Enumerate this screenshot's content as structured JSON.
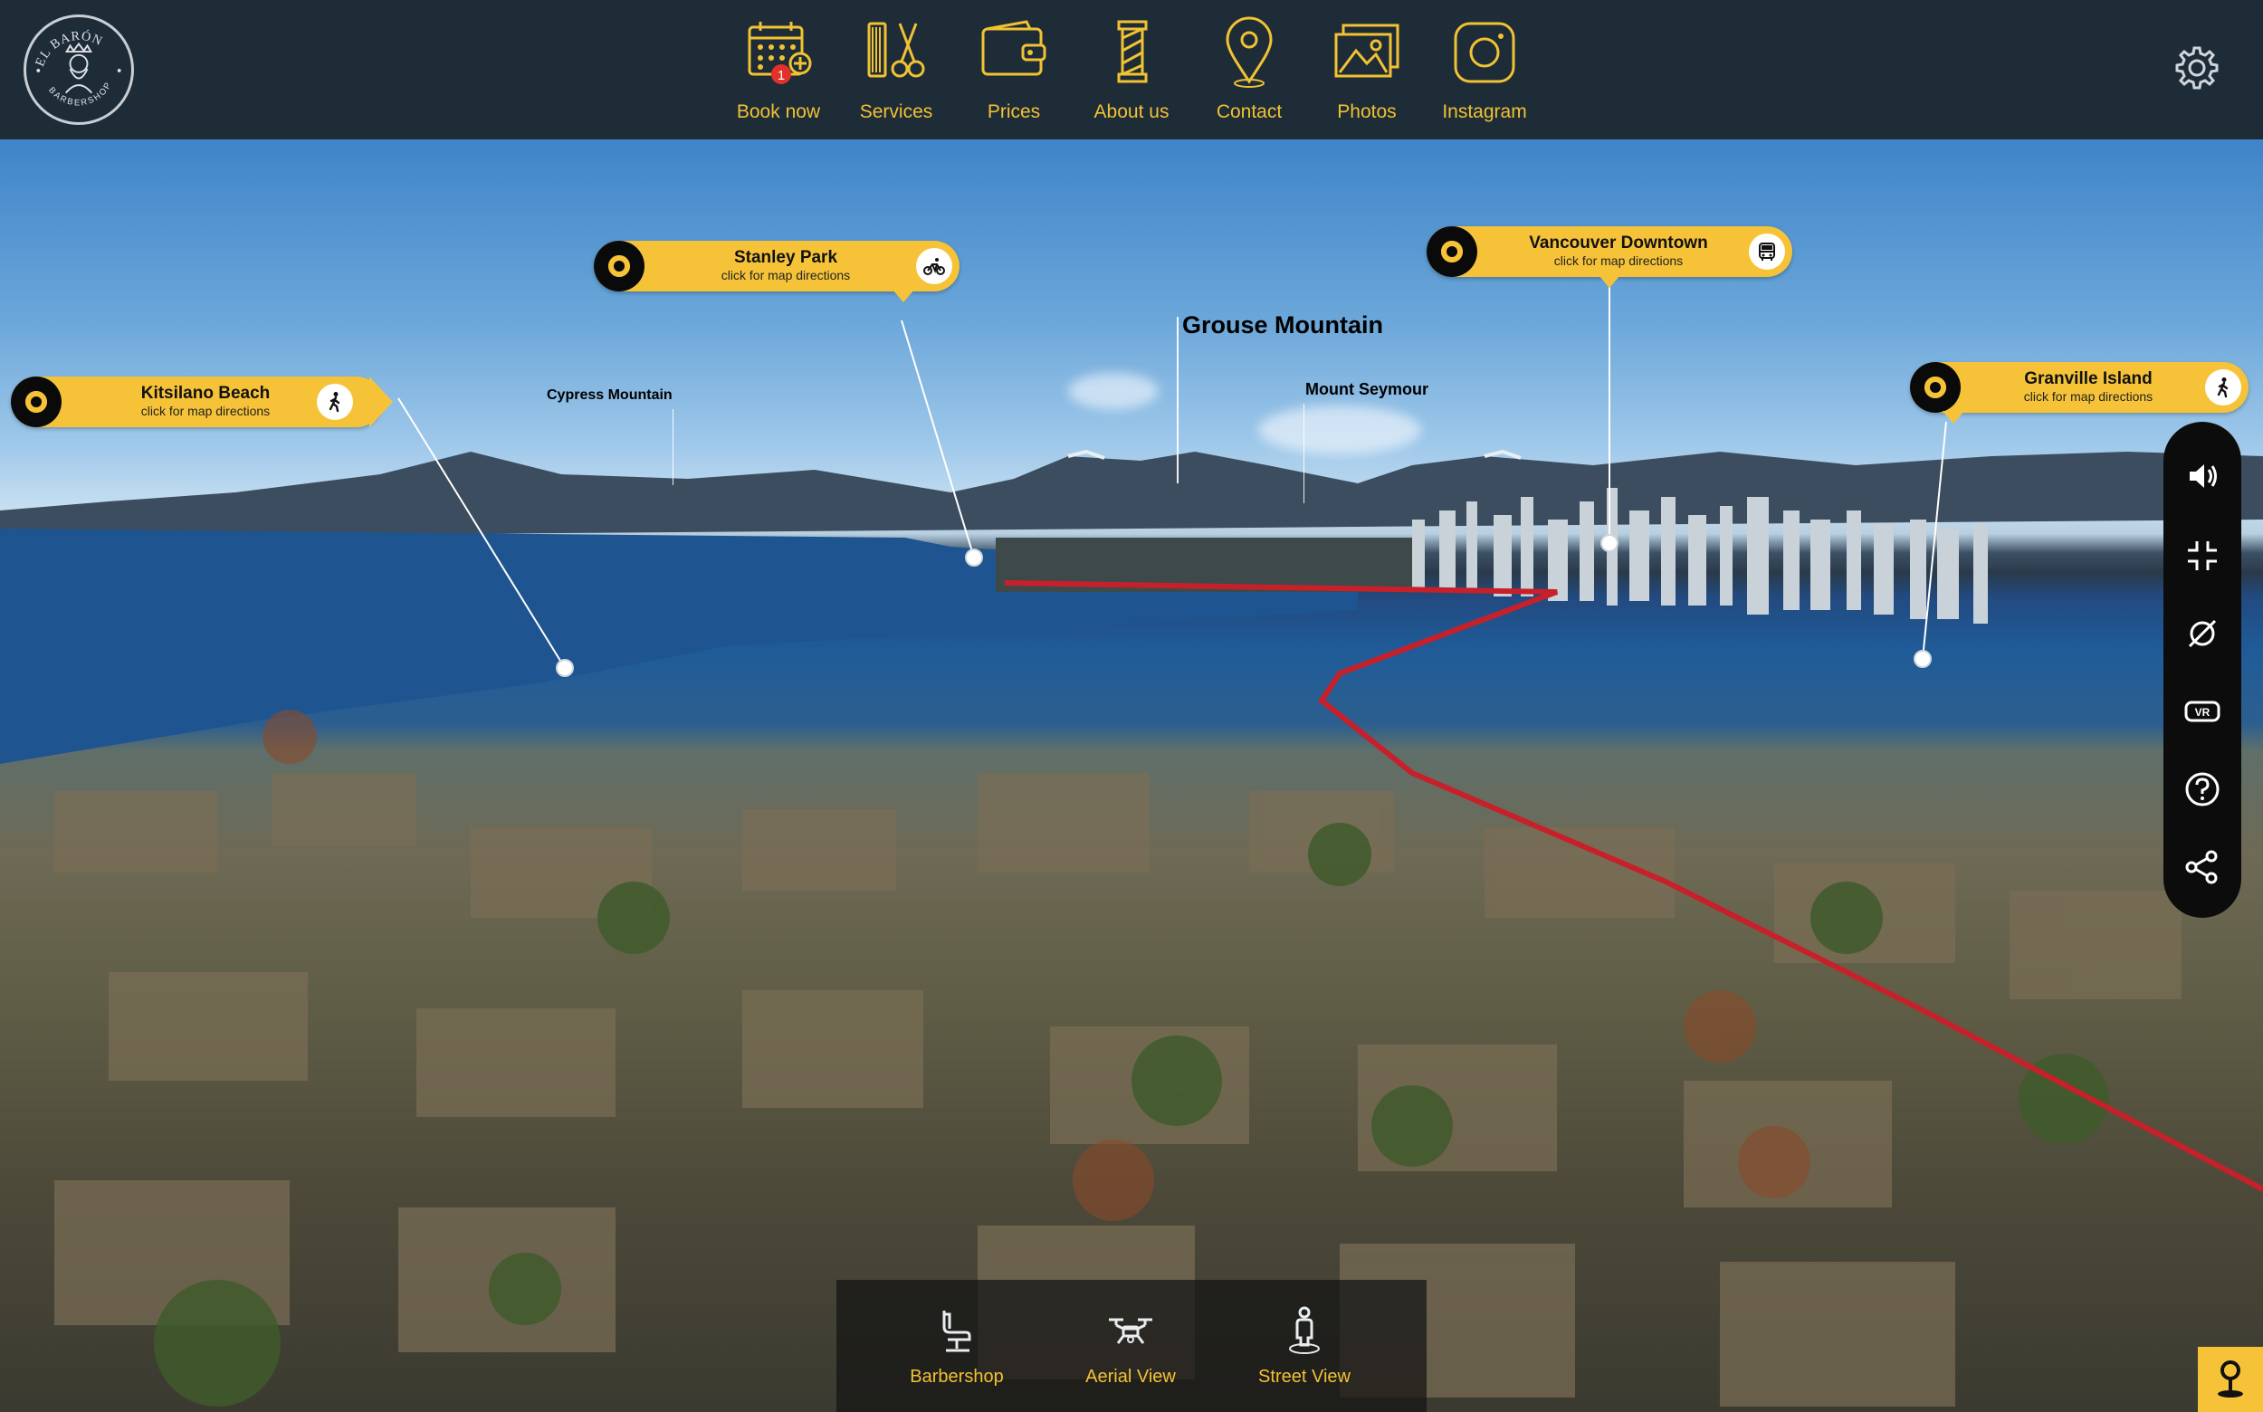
{
  "brand": {
    "name": "EL BARÓN",
    "subtitle": "BARBERSHOP"
  },
  "nav": [
    {
      "id": "book",
      "label": "Book now",
      "icon": "calendar-plus-icon",
      "badge": "1"
    },
    {
      "id": "services",
      "label": "Services",
      "icon": "comb-scissors-icon"
    },
    {
      "id": "prices",
      "label": "Prices",
      "icon": "wallet-icon"
    },
    {
      "id": "about",
      "label": "About us",
      "icon": "barber-pole-icon"
    },
    {
      "id": "contact",
      "label": "Contact",
      "icon": "location-pin-icon"
    },
    {
      "id": "photos",
      "label": "Photos",
      "icon": "photos-icon"
    },
    {
      "id": "instagram",
      "label": "Instagram",
      "icon": "instagram-icon"
    }
  ],
  "settings_icon": "gear-icon",
  "pins": [
    {
      "title": "Kitsilano Beach",
      "subtitle": "click for map directions",
      "icon": "walking-icon"
    },
    {
      "title": "Stanley Park",
      "subtitle": "click for map directions",
      "icon": "bicycle-icon"
    },
    {
      "title": "Vancouver Downtown",
      "subtitle": "click for map directions",
      "icon": "bus-icon"
    },
    {
      "title": "Granville Island",
      "subtitle": "click for map directions",
      "icon": "walking-icon"
    }
  ],
  "peaks": {
    "grouse": "Grouse Mountain",
    "cypress": "Cypress Mountain",
    "seymour": "Mount Seymour"
  },
  "right_toolbar": [
    "volume-icon",
    "fullscreen-exit-icon",
    "gyro-off-icon",
    "vr-icon",
    "help-icon",
    "share-icon"
  ],
  "dock": [
    {
      "label": "Barbershop",
      "icon": "barber-chair-icon"
    },
    {
      "label": "Aerial View",
      "icon": "drone-icon"
    },
    {
      "label": "Street View",
      "icon": "person-pin-icon"
    }
  ],
  "colors": {
    "accent": "#f1c232",
    "pin": "#f6c338",
    "topbar": "#1e2c38",
    "route": "#c8202a"
  }
}
